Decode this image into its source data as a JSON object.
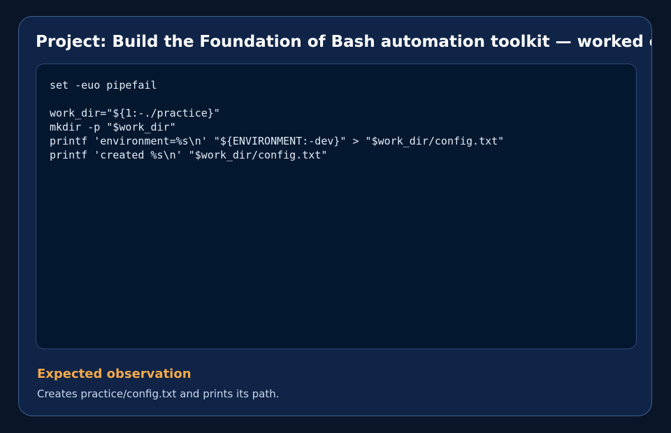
{
  "card": {
    "title": "Project: Build the Foundation of Bash automation toolkit — worked example",
    "code": "set -euo pipefail\n\nwork_dir=\"${1:-./practice}\"\nmkdir -p \"$work_dir\"\nprintf 'environment=%s\\n' \"${ENVIRONMENT:-dev}\" > \"$work_dir/config.txt\"\nprintf 'created %s\\n' \"$work_dir/config.txt\"",
    "observation_heading": "Expected observation",
    "observation_text": "Creates practice/config.txt and prints its path."
  },
  "colors": {
    "background": "#0a1528",
    "card": "#0f2447",
    "code_background": "#03172f",
    "accent": "#f5a94a",
    "title": "#ffffff"
  }
}
